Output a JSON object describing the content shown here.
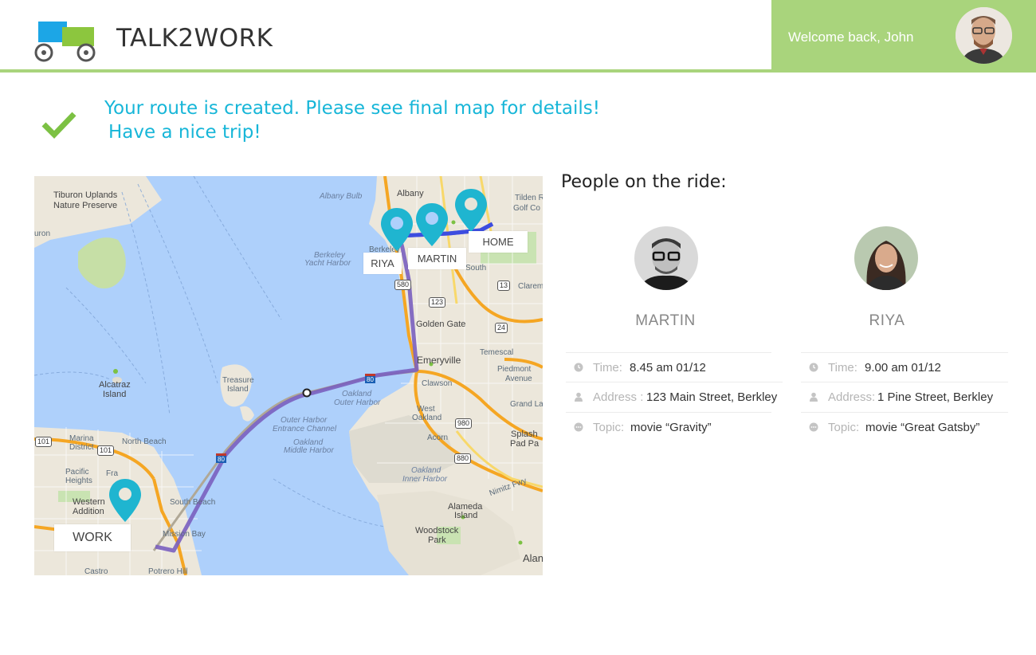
{
  "app": {
    "title": "TALK2WORK",
    "welcome": "Welcome back, John"
  },
  "colors": {
    "accent_green": "#a9d47c",
    "message_blue": "#17b6d8",
    "pin_teal": "#1fb5d0",
    "route_purple": "#7a5fbf"
  },
  "message": {
    "line1": "Your route is created. Please see final map for details!",
    "line2": "Have a nice trip!"
  },
  "map": {
    "pins": {
      "home": "HOME",
      "martin": "MARTIN",
      "riya": "RIYA",
      "work": "WORK"
    },
    "labels": {
      "tiburon": "Tiburon Uplands",
      "nature_preserve": "Nature Preserve",
      "albany_bulb": "Albany Bulb",
      "albany": "Albany",
      "tilden": "Tilden R",
      "golf": "Golf Co",
      "berkeley": "Berkeley",
      "berkeley_yacht": "Berkeley",
      "yacht_harbor": "Yacht Harbor",
      "south": "South",
      "claremont": "Claremo",
      "golden_gate": "Golden Gate",
      "temescal": "Temescal",
      "emeryville": "Emeryville",
      "piedmont": "Piedmont",
      "piedmont_ave": "Avenue",
      "treasure": "Treasure",
      "island": "Island",
      "alcatraz": "Alcatraz",
      "alcatraz_island": "Island",
      "clawson": "Clawson",
      "oakland": "Oakland",
      "outer_harbor": "Outer Harbor",
      "west": "West",
      "west_oakland": "Oakland",
      "grand_lake": "Grand La",
      "outer_harbor_channel": "Outer Harbor",
      "entrance_channel": "Entrance Channel",
      "oakland_middle": "Oakland",
      "middle_harbor": "Middle Harbor",
      "acorn": "Acorn",
      "splash": "Splash",
      "pad_park": "Pad Pa",
      "marina": "Marina",
      "district": "District",
      "north_beach": "North Beach",
      "pacific": "Pacific",
      "heights": "Heights",
      "inner_harbor": "Inner Harbor",
      "oakland_inner": "Oakland",
      "nimitz": "Nimitz Fwy",
      "western": "Western",
      "addition": "Addition",
      "south_beach": "South Beach",
      "alameda": "Alameda",
      "alameda_island": "Island",
      "mission_bay": "Mission Bay",
      "woodstock": "Woodstock",
      "park": "Park",
      "alan": "Alan",
      "castro": "Castro",
      "potrero": "Potrero Hill",
      "uron": "uron",
      "francisco": "Fra"
    },
    "shields": [
      "580",
      "123",
      "13",
      "24",
      "80",
      "980",
      "880",
      "101",
      "101",
      "80"
    ]
  },
  "people": {
    "title": "People on the ride:",
    "list": [
      {
        "name": "MARTIN",
        "time_label": "Time:",
        "time": "8.45 am  01/12",
        "address_label": "Address :",
        "address": "123 Main Street, Berkley",
        "topic_label": "Topic:",
        "topic": "movie “Gravity”"
      },
      {
        "name": "RIYA",
        "time_label": "Time:",
        "time": "9.00 am  01/12",
        "address_label": "Address:",
        "address": "1  Pine  Street, Berkley",
        "topic_label": "Topic:",
        "topic": "movie “Great Gatsby”"
      }
    ]
  }
}
